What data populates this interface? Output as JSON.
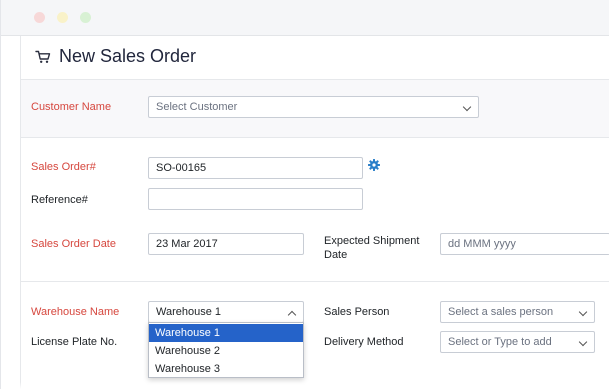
{
  "page": {
    "title": "New Sales Order",
    "cart_icon": "shopping-cart-icon"
  },
  "customer": {
    "label": "Customer Name",
    "placeholder": "Select Customer"
  },
  "sales_order": {
    "label": "Sales Order#",
    "value": "SO-00165",
    "settings_icon": "gear-icon"
  },
  "reference": {
    "label": "Reference#",
    "value": ""
  },
  "sales_order_date": {
    "label": "Sales Order Date",
    "value": "23 Mar 2017"
  },
  "expected_shipment_date": {
    "label_line1": "Expected Shipment",
    "label_line2": "Date",
    "placeholder": "dd MMM yyyy"
  },
  "warehouse": {
    "label": "Warehouse Name",
    "value": "Warehouse 1",
    "options": [
      "Warehouse 1",
      "Warehouse 2",
      "Warehouse 3"
    ],
    "selected": "Warehouse 1"
  },
  "sales_person": {
    "label": "Sales Person",
    "placeholder": "Select a sales person"
  },
  "license_plate": {
    "label": "License Plate No."
  },
  "delivery_method": {
    "label": "Delivery Method",
    "placeholder": "Select or Type to add"
  },
  "colors": {
    "required_label": "#d6473e",
    "accent": "#2a7fc9",
    "selected_option": "#2563c9"
  }
}
